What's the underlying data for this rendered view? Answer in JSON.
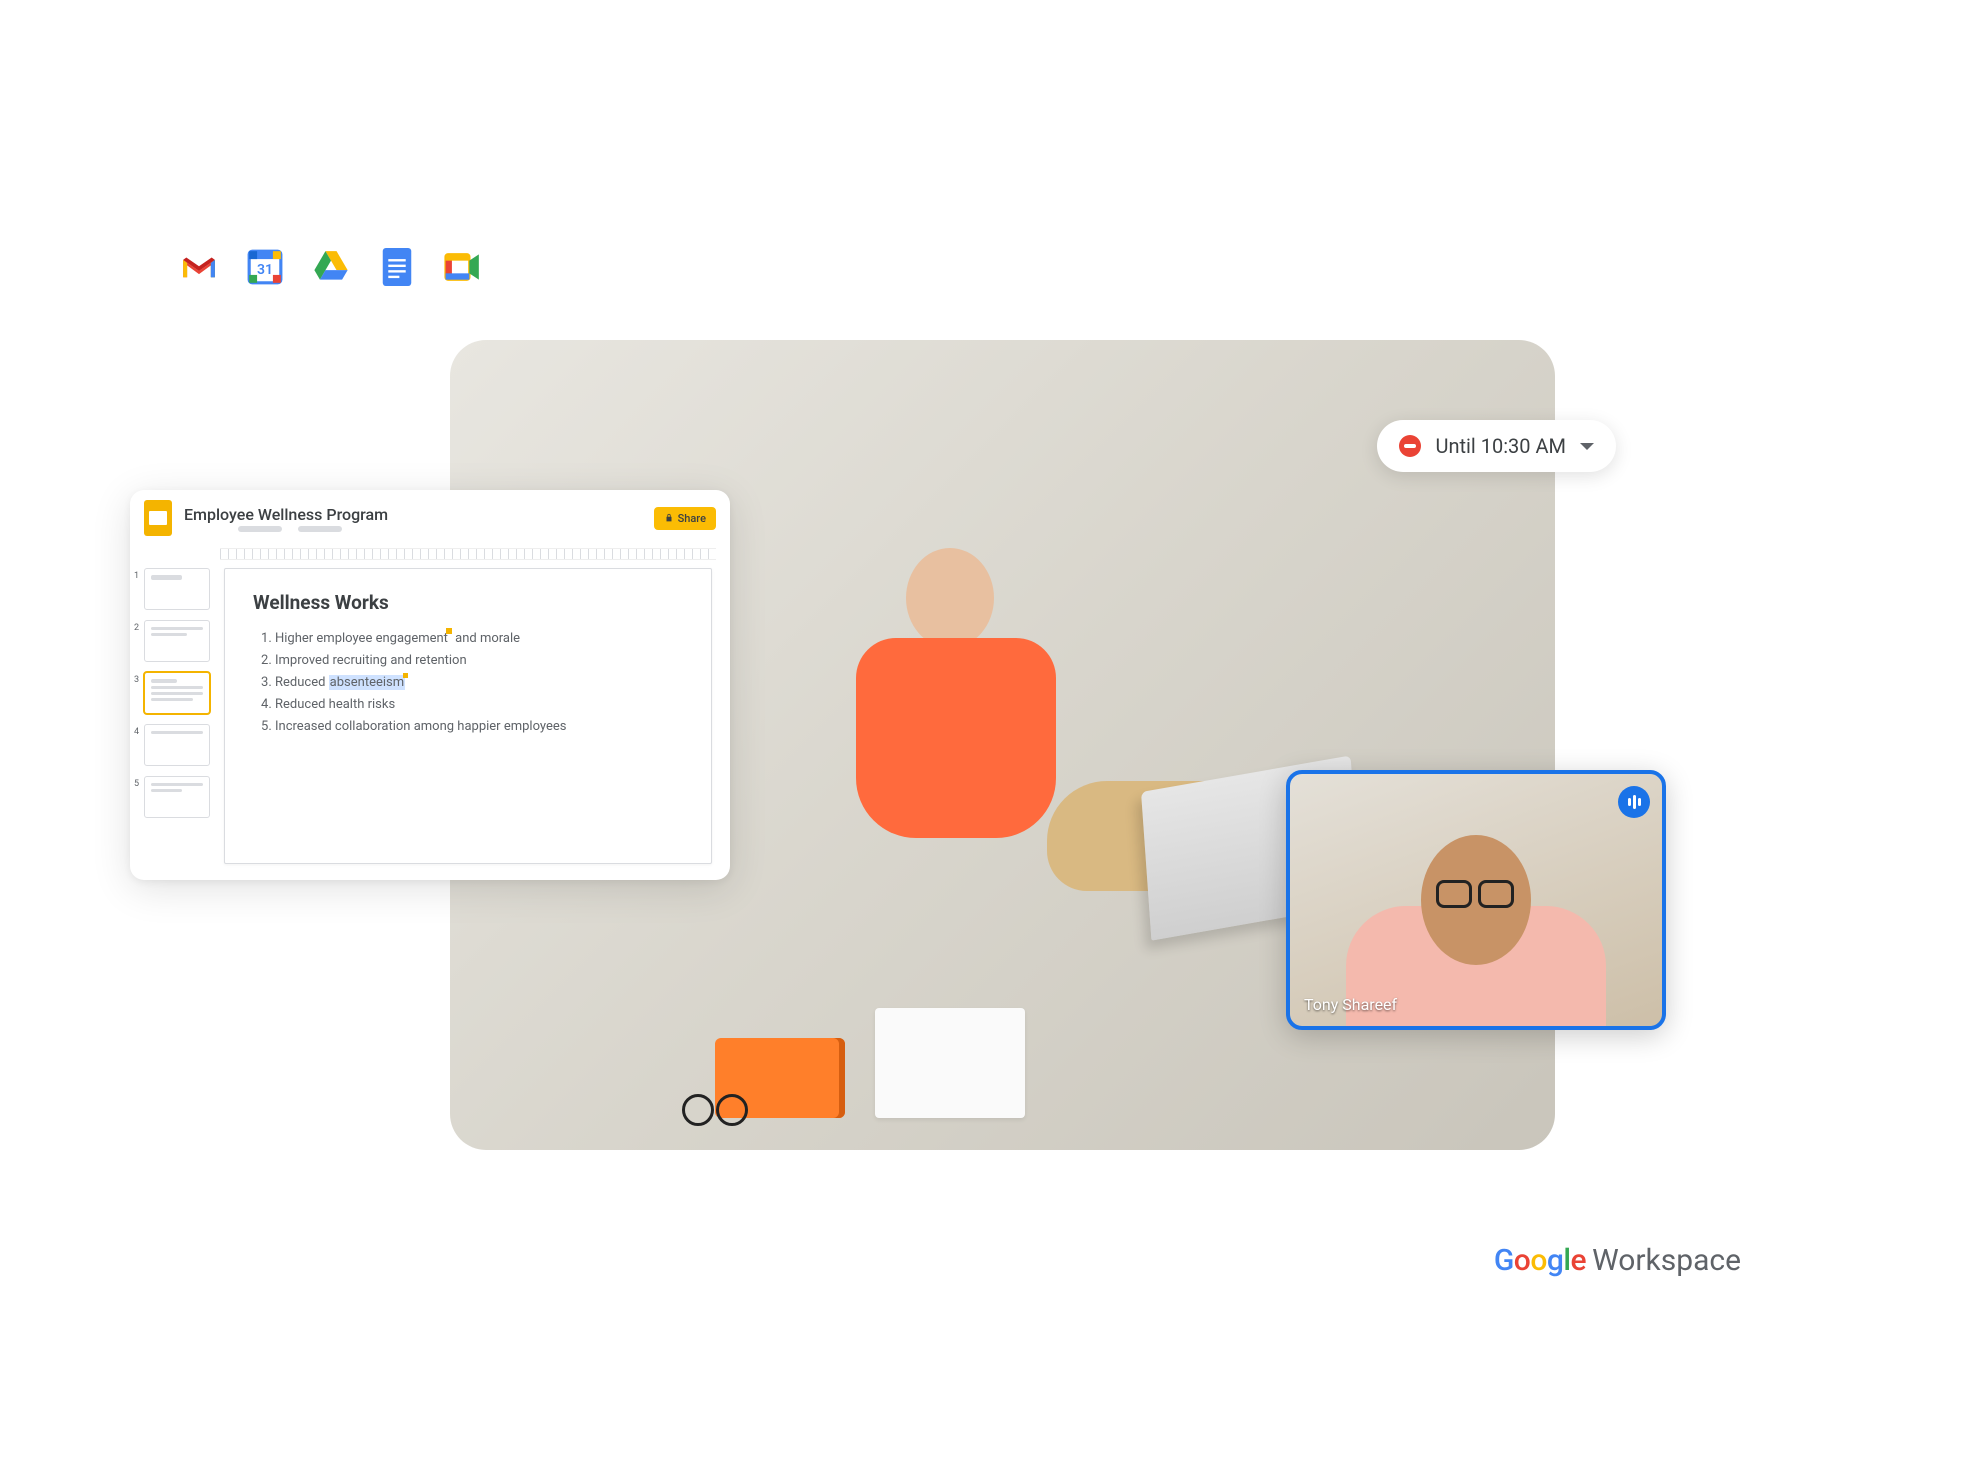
{
  "app_icons": [
    "gmail",
    "calendar",
    "drive",
    "docs",
    "meet"
  ],
  "calendar_day": "31",
  "status": {
    "label": "Until 10:30 AM"
  },
  "slides": {
    "doc_title": "Employee Wellness Program",
    "share_label": "Share",
    "thumbnails": [
      "1",
      "2",
      "3",
      "4",
      "5"
    ],
    "selected_thumb_index": 2,
    "slide_title": "Wellness Works",
    "bullets": [
      "Higher employee engagement and morale",
      "Improved recruiting and retention",
      "Reduced absenteeism",
      "Reduced health risks",
      "Increased collaboration among happier employees"
    ],
    "selection_word": "absenteeism"
  },
  "meet": {
    "participant_name": "Tony Shareef"
  },
  "branding": {
    "google": "Google",
    "workspace": "Workspace"
  }
}
